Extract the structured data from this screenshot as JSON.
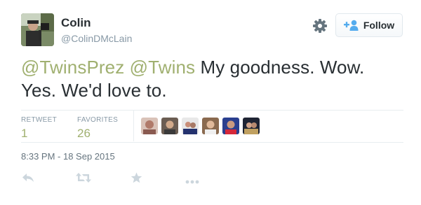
{
  "user": {
    "name": "Colin",
    "handle": "@ColinDMcLain"
  },
  "follow_button": {
    "label": "Follow"
  },
  "tweet": {
    "mention_1": "@TwinsPrez",
    "mention_2": "@Twins",
    "text_line_1_rest": " My goodness. Wow.",
    "text_line_2": "Yes. We'd love to."
  },
  "stats": {
    "retweets_label": "RETWEET",
    "retweets_value": "1",
    "favorites_label": "FAVORITES",
    "favorites_value": "26"
  },
  "timestamp": "8:33 PM - 18 Sep 2015",
  "colors": {
    "mention": "#a0b070",
    "text": "#292f33",
    "muted": "#8899a6",
    "divider": "#e8edf0"
  },
  "icons": {
    "settings": "gear-icon",
    "follow": "add-person-icon",
    "reply": "reply-icon",
    "retweet": "retweet-icon",
    "favorite": "star-icon",
    "more": "more-icon"
  }
}
